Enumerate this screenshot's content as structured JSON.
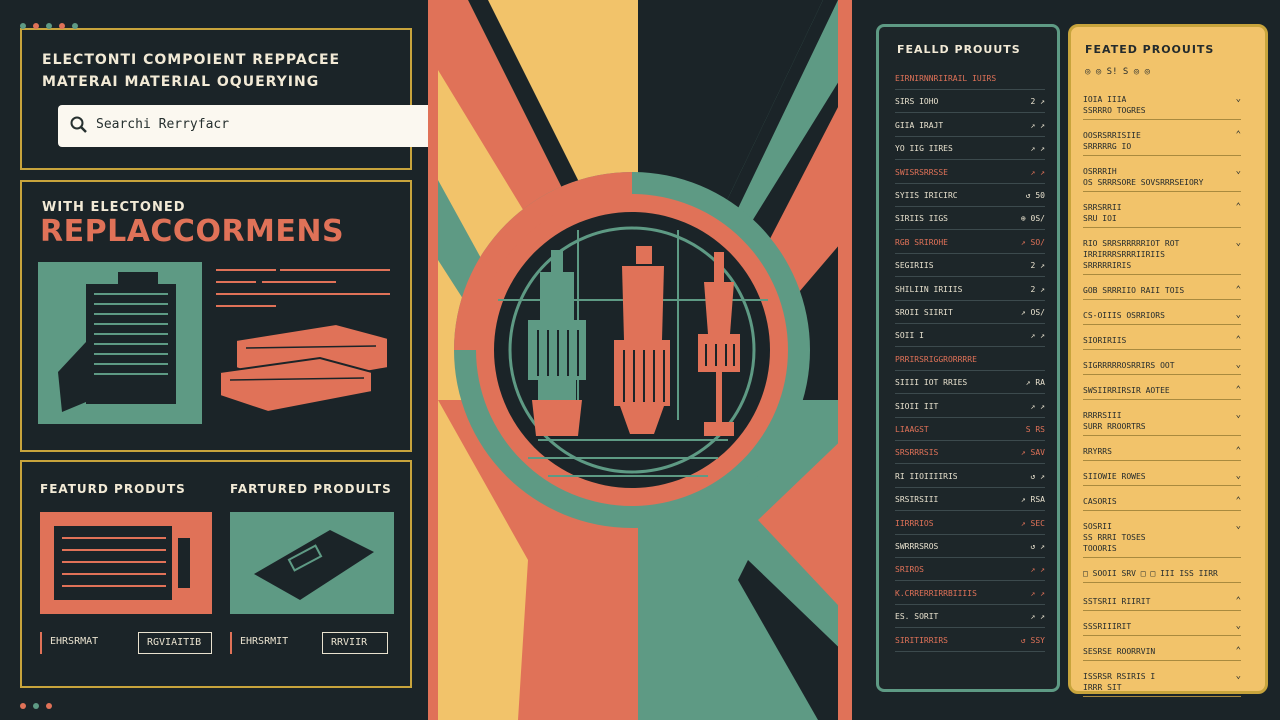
{
  "header": {
    "line1": "ELECTONTI COMPOIENT REPPACEE",
    "line2": "MATERAI MATERIAL OQUERYING"
  },
  "search": {
    "placeholder": "Searchi Rerryfacr",
    "icon": "search-icon"
  },
  "promo": {
    "subtitle": "WITH ELECTONED",
    "title": "REPLACCORMENS"
  },
  "featured": [
    {
      "label": "FEATURD PRODUTS",
      "button1": "EHRSRMAT",
      "button2": "RGVIAITIB"
    },
    {
      "label": "FARTURED PRODULTS",
      "button1": "EHRSRMIT",
      "button2": "RRVIIR"
    }
  ],
  "list1": {
    "title": "FEALLD PROUUTS",
    "rows": [
      {
        "label": "EIRNIRNNRIIRAIL IUIRS",
        "value": "",
        "accent": true
      },
      {
        "label": "SIRS IOHO",
        "value": "2 ↗"
      },
      {
        "label": "GIIA IRAJT",
        "value": "↗ ↗"
      },
      {
        "label": "YO IIG IIRES",
        "value": "↗ ↗"
      },
      {
        "label": "SWISRSRRSSE",
        "value": "↗ ↗",
        "accent": true
      },
      {
        "label": "SYIIS IRICIRC",
        "value": "↺ 50"
      },
      {
        "label": "SIRIIS IIGS",
        "value": "⊕ 0S/"
      },
      {
        "label": "RGB SRIROHE",
        "value": "↗ SO/",
        "accent": true
      },
      {
        "label": "SEGIRIIS",
        "value": "2 ↗"
      },
      {
        "label": "SHILIIN IRIIIS",
        "value": "2 ↗"
      },
      {
        "label": "SROII SIIRIT",
        "value": "↗ OS/"
      },
      {
        "label": "SOII I",
        "value": "↗ ↗"
      },
      {
        "label": "PRRIRSRIGGRORRRRE",
        "value": "",
        "accent": true
      },
      {
        "label": "SIIII IOT RRIES",
        "value": "↗ RA",
        "accent": false
      },
      {
        "label": "SIOII IIT",
        "value": "↗ ↗"
      },
      {
        "label": "LIAAGST",
        "value": "S RS",
        "accent": true
      },
      {
        "label": "SRSRRRSIS",
        "value": "↗ SAV",
        "accent": true
      },
      {
        "label": "RI IIOIIIIRIS",
        "value": "↺ ↗"
      },
      {
        "label": "SRSIRSIII",
        "value": "↗ RSA"
      },
      {
        "label": "IIRRRIOS",
        "value": "↗ SEC",
        "accent": true
      },
      {
        "label": "SWRRRSROS",
        "value": "↺ ↗"
      },
      {
        "label": "SRIROS",
        "value": "↗ ↗",
        "accent": true
      },
      {
        "label": "K.CRRERRIRRBIIIIS",
        "value": "↗ ↗",
        "accent": true
      },
      {
        "label": "ES. SORIT",
        "value": "↗ ↗"
      },
      {
        "label": "SIRITIRRIRS",
        "value": "↺ SSY",
        "accent": true
      }
    ]
  },
  "list2": {
    "title": "FEATED PROOUITS",
    "icon_row": "◎ ◎ S! S ◎ ◎",
    "rows": [
      {
        "label": "IOIA IIIA\nSSRRRO TOGRES"
      },
      {
        "label": "OOSRSRRISIIE\nSRRRRRG IO"
      },
      {
        "label": "OSRRRIH\nOS SRRRSORE SOVSRRRSEIORY"
      },
      {
        "label": "SRRSRRII\nSRU IOI"
      },
      {
        "label": "RIO SRRSRRRRRIOT ROT\nIRRIRRRSRRRIIRIIS\nSRRRRRIRIS"
      },
      {
        "label": "GOB SRRRIIO RAII TOIS"
      },
      {
        "label": "CS-OIIIS OSRRIORS"
      },
      {
        "label": "SIORIRIIS"
      },
      {
        "label": "SIGRRRRROSRRIRS OOT"
      },
      {
        "label": "SWSIIRRIRSIR AOTEE"
      },
      {
        "label": "RRRRSIII\nSURR RROORTRS"
      },
      {
        "label": "RRYRRS"
      },
      {
        "label": "SIIOWIE ROWES"
      },
      {
        "label": "CASORIS"
      },
      {
        "label": "SOSRII\nSS RRRI TOSES\nTOOORIS"
      },
      {
        "label": "SSTSRII RIIRIT"
      },
      {
        "label": "SSSRIIIRIT"
      },
      {
        "label": "SESRSE ROORRVIN"
      },
      {
        "label": "ISSRSR RSIRIS I\nIRRR SIT"
      }
    ],
    "toolbar_row": "□ SOOII SRV □ □ III ISS IIRR"
  },
  "colors": {
    "background": "#1b2428",
    "coral": "#e07258",
    "teal": "#5e9a84",
    "mustard": "#f2c36a",
    "gold": "#c8a43c",
    "cream": "#fbf8f0"
  }
}
